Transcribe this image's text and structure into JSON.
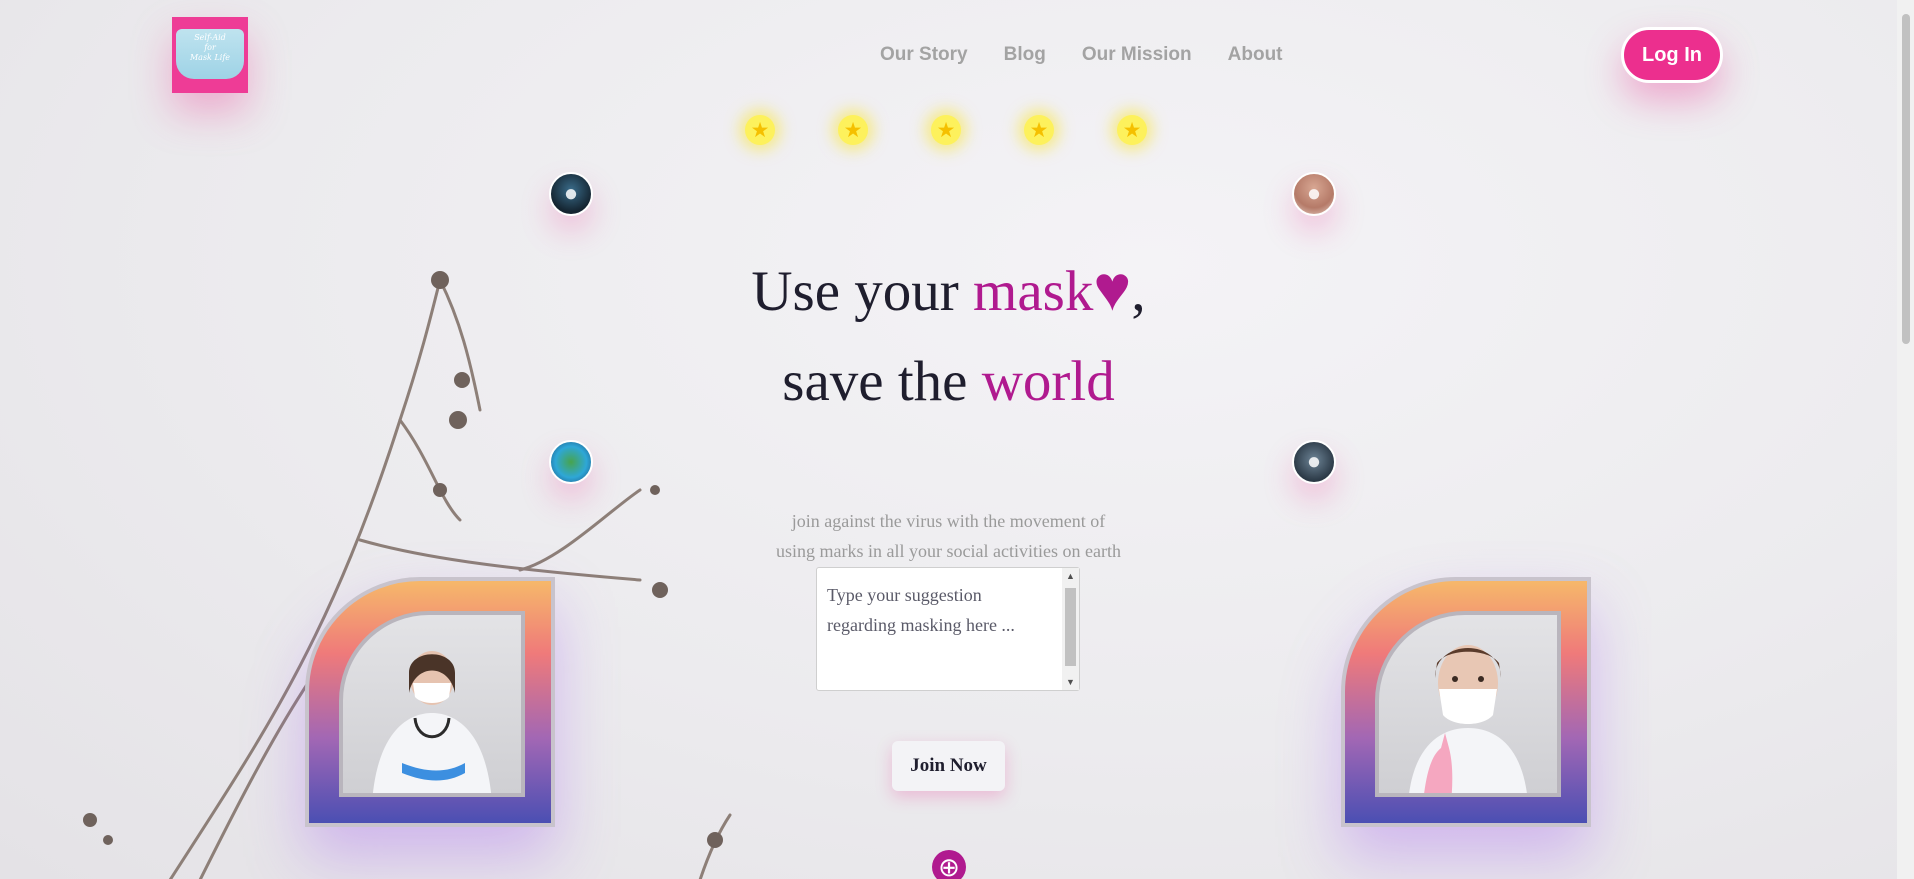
{
  "brand": {
    "logo_text": [
      "Self-Aid",
      "for",
      "Mask Life"
    ]
  },
  "nav": {
    "items": [
      "Our Story",
      "Blog",
      "Our Mission",
      "About"
    ]
  },
  "header": {
    "login_label": "Log In"
  },
  "rating": {
    "stars": 5
  },
  "hero": {
    "line1_pre": "Use your ",
    "line1_accent": "mask",
    "line1_post": ",",
    "line2_pre": "save the ",
    "line2_accent": "world"
  },
  "subtext": {
    "line1": "join against the virus with the movement of",
    "line2": "using marks in all your social activities on earth"
  },
  "suggestion": {
    "placeholder": "Type your suggestion regarding masking here ...",
    "value": ""
  },
  "cta": {
    "join_label": "Join Now"
  },
  "colors": {
    "accent": "#b01a8f",
    "brand_pink": "#ec2f8e",
    "star": "#fdf15c",
    "text_dark": "#1f1e2e"
  }
}
